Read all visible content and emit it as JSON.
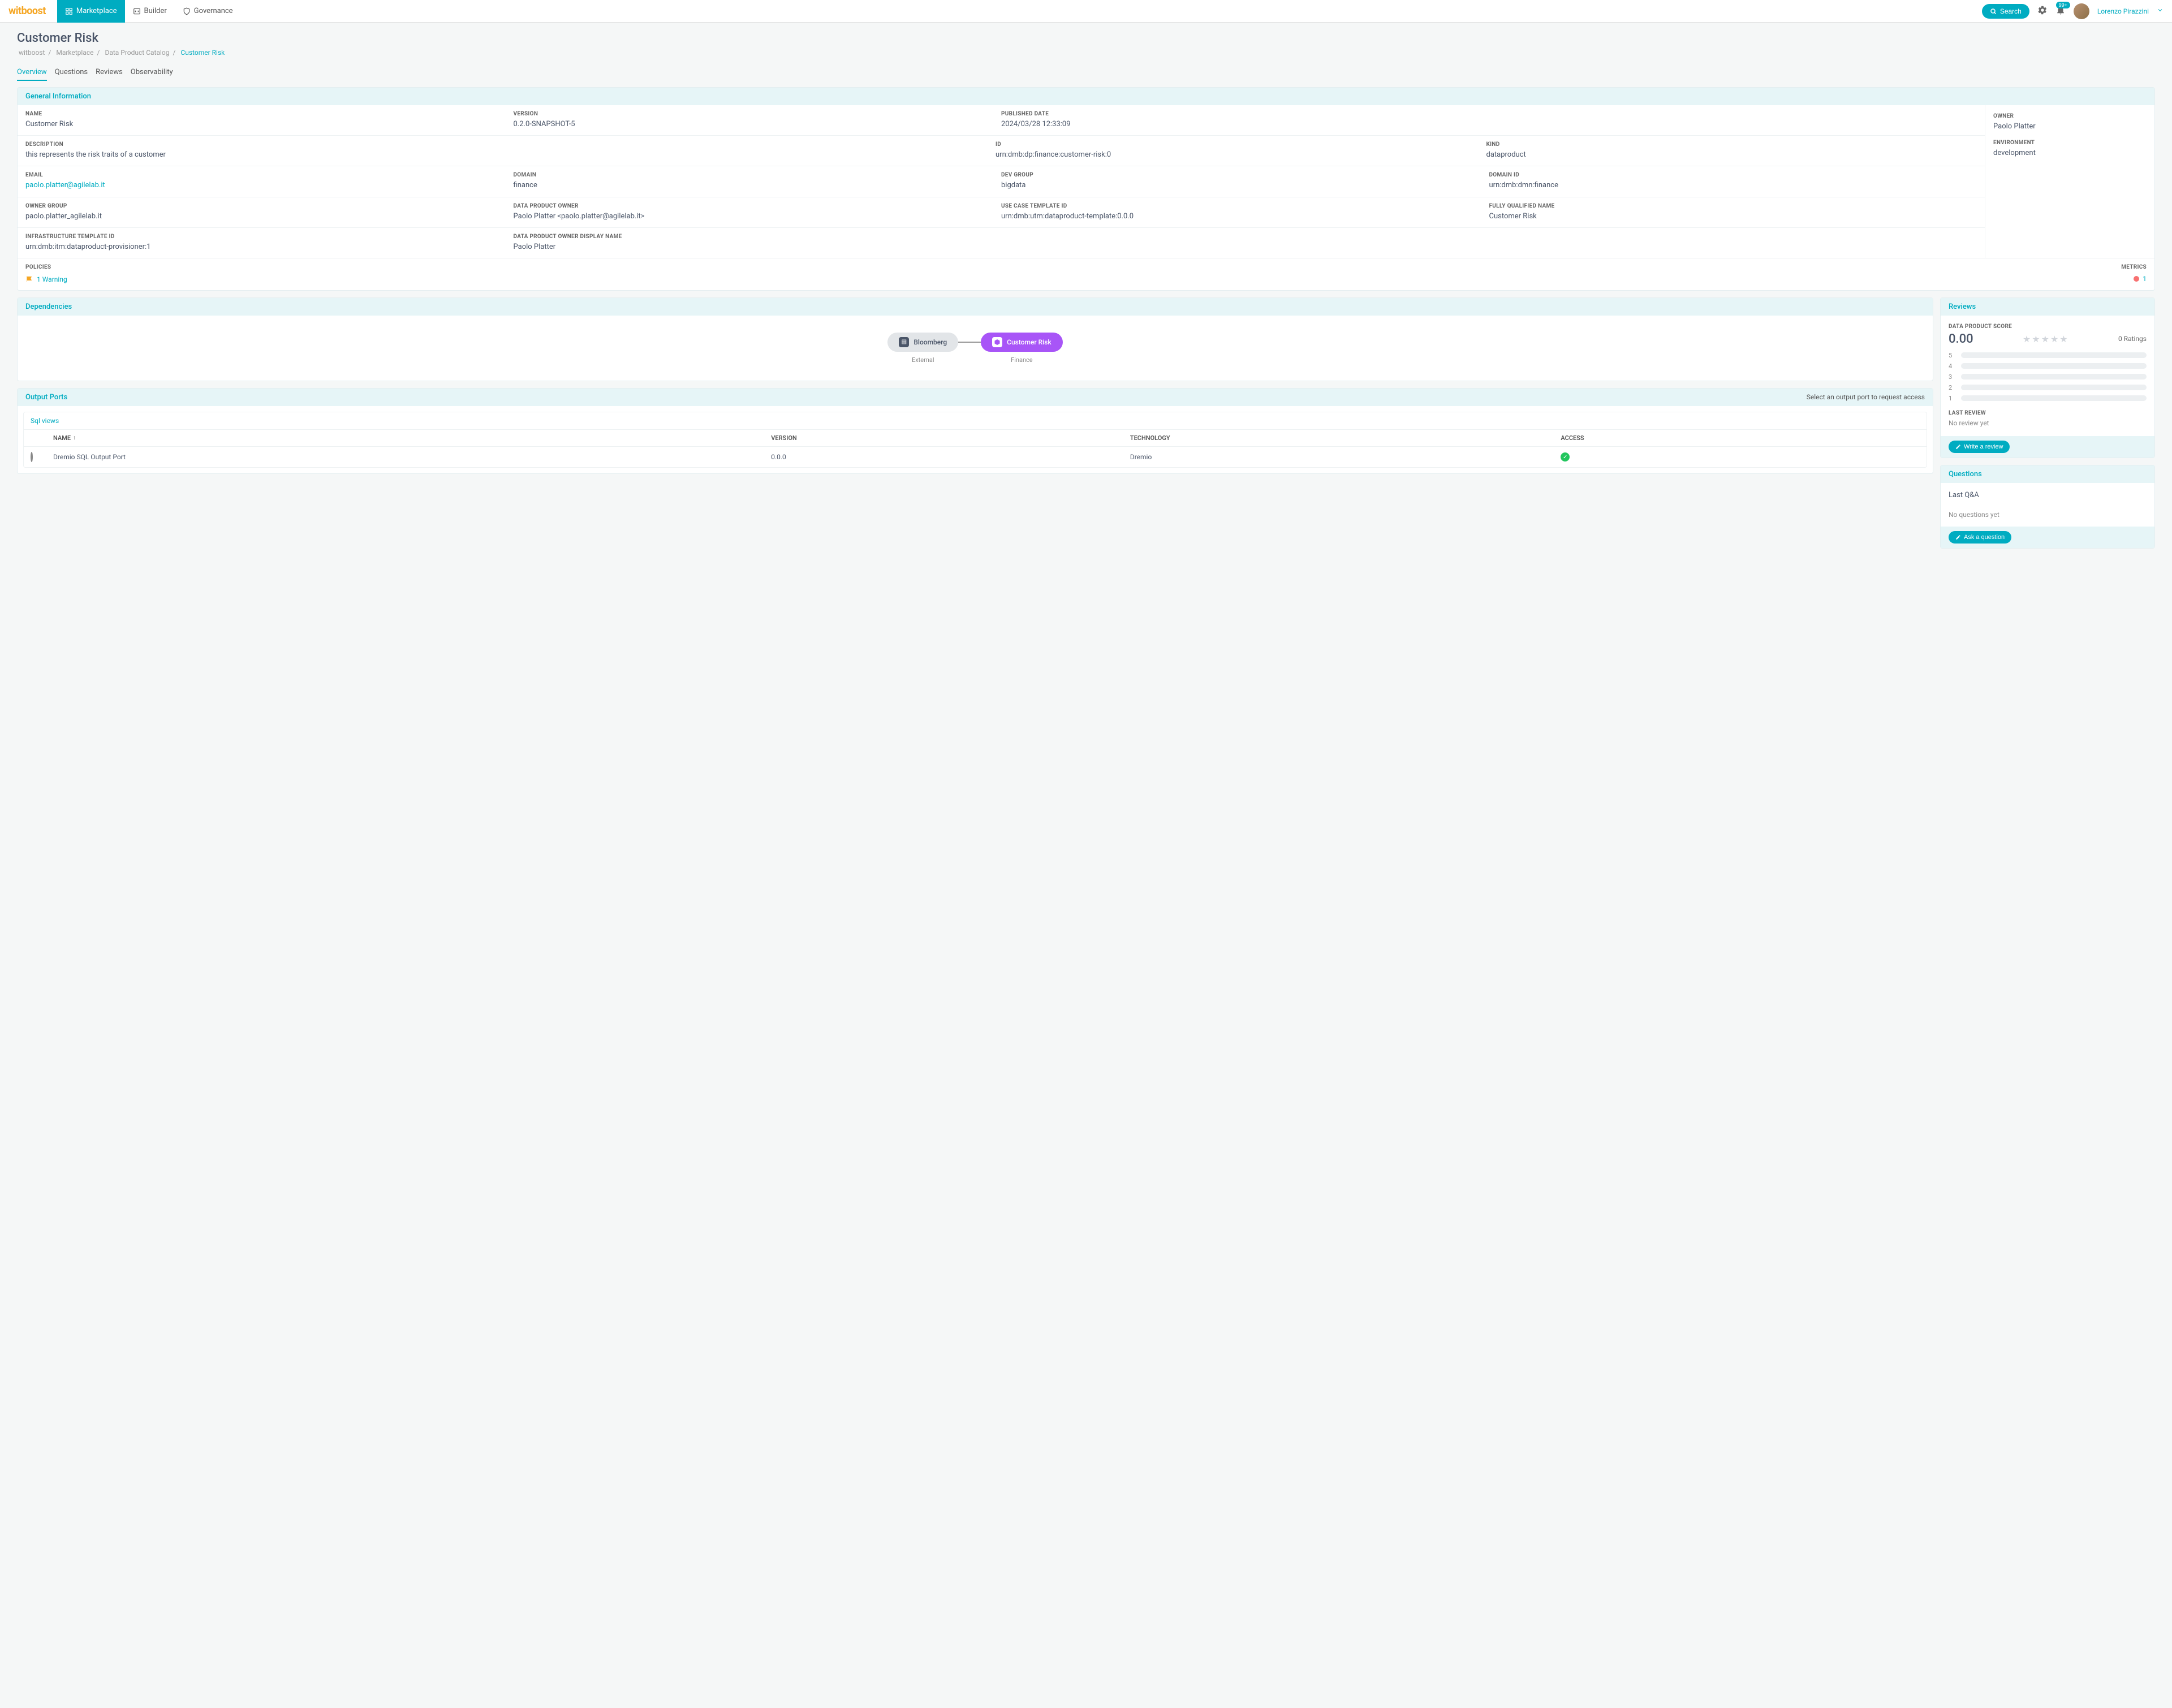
{
  "header": {
    "logo": "witboost",
    "nav": {
      "marketplace": "Marketplace",
      "builder": "Builder",
      "governance": "Governance"
    },
    "search": "Search",
    "notification_badge": "99+",
    "username": "Lorenzo Pirazzini"
  },
  "page": {
    "title": "Customer Risk",
    "breadcrumb": {
      "b0": "witboost",
      "b1": "Marketplace",
      "b2": "Data Product Catalog",
      "b3": "Customer Risk"
    },
    "tabs": {
      "overview": "Overview",
      "questions": "Questions",
      "reviews": "Reviews",
      "observability": "Observability"
    }
  },
  "general": {
    "title": "General Information",
    "name_label": "NAME",
    "name": "Customer Risk",
    "version_label": "VERSION",
    "version": "0.2.0-SNAPSHOT-5",
    "published_label": "PUBLISHED DATE",
    "published": "2024/03/28 12:33:09",
    "description_label": "DESCRIPTION",
    "description": "this represents the risk traits of a customer",
    "id_label": "ID",
    "id": "urn:dmb:dp:finance:customer-risk:0",
    "kind_label": "KIND",
    "kind": "dataproduct",
    "email_label": "EMAIL",
    "email": "paolo.platter@agilelab.it",
    "domain_label": "DOMAIN",
    "domain": "finance",
    "devgroup_label": "DEV GROUP",
    "devgroup": "bigdata",
    "domainid_label": "DOMAIN ID",
    "domainid": "urn:dmb:dmn:finance",
    "ownergroup_label": "OWNER GROUP",
    "ownergroup": "paolo.platter_agilelab.it",
    "dpo_label": "DATA PRODUCT OWNER",
    "dpo": "Paolo Platter <paolo.platter@agilelab.it>",
    "usecase_label": "USE CASE TEMPLATE ID",
    "usecase": "urn:dmb:utm:dataproduct-template:0.0.0",
    "fqn_label": "FULLY QUALIFIED NAME",
    "fqn": "Customer Risk",
    "infra_label": "INFRASTRUCTURE TEMPLATE ID",
    "infra": "urn:dmb:itm:dataproduct-provisioner:1",
    "dpodn_label": "DATA PRODUCT OWNER DISPLAY NAME",
    "dpodn": "Paolo Platter",
    "owner_label": "OWNER",
    "owner": "Paolo Platter",
    "env_label": "ENVIRONMENT",
    "env": "development",
    "policies_label": "POLICIES",
    "policies_warning": "1 Warning",
    "metrics_label": "METRICS",
    "metrics_count": "1"
  },
  "deps": {
    "title": "Dependencies",
    "node1": "Bloomberg",
    "node1_sub": "External",
    "node2": "Customer Risk",
    "node2_sub": "Finance"
  },
  "ports": {
    "title": "Output Ports",
    "hint": "Select an output port to request access",
    "subhead": "Sql views",
    "col_name": "NAME",
    "col_version": "VERSION",
    "col_tech": "TECHNOLOGY",
    "col_access": "ACCESS",
    "row_name": "Dremio SQL Output Port",
    "row_version": "0.0.0",
    "row_tech": "Dremio"
  },
  "reviews": {
    "title": "Reviews",
    "score_label": "DATA PRODUCT SCORE",
    "score": "0.00",
    "ratings": "0 Ratings",
    "r5": "5",
    "r4": "4",
    "r3": "3",
    "r2": "2",
    "r1": "1",
    "last_label": "LAST REVIEW",
    "last_none": "No review yet",
    "write": "Write a review"
  },
  "questions": {
    "title": "Questions",
    "last": "Last Q&A",
    "none": "No questions yet",
    "ask": "Ask a question"
  }
}
